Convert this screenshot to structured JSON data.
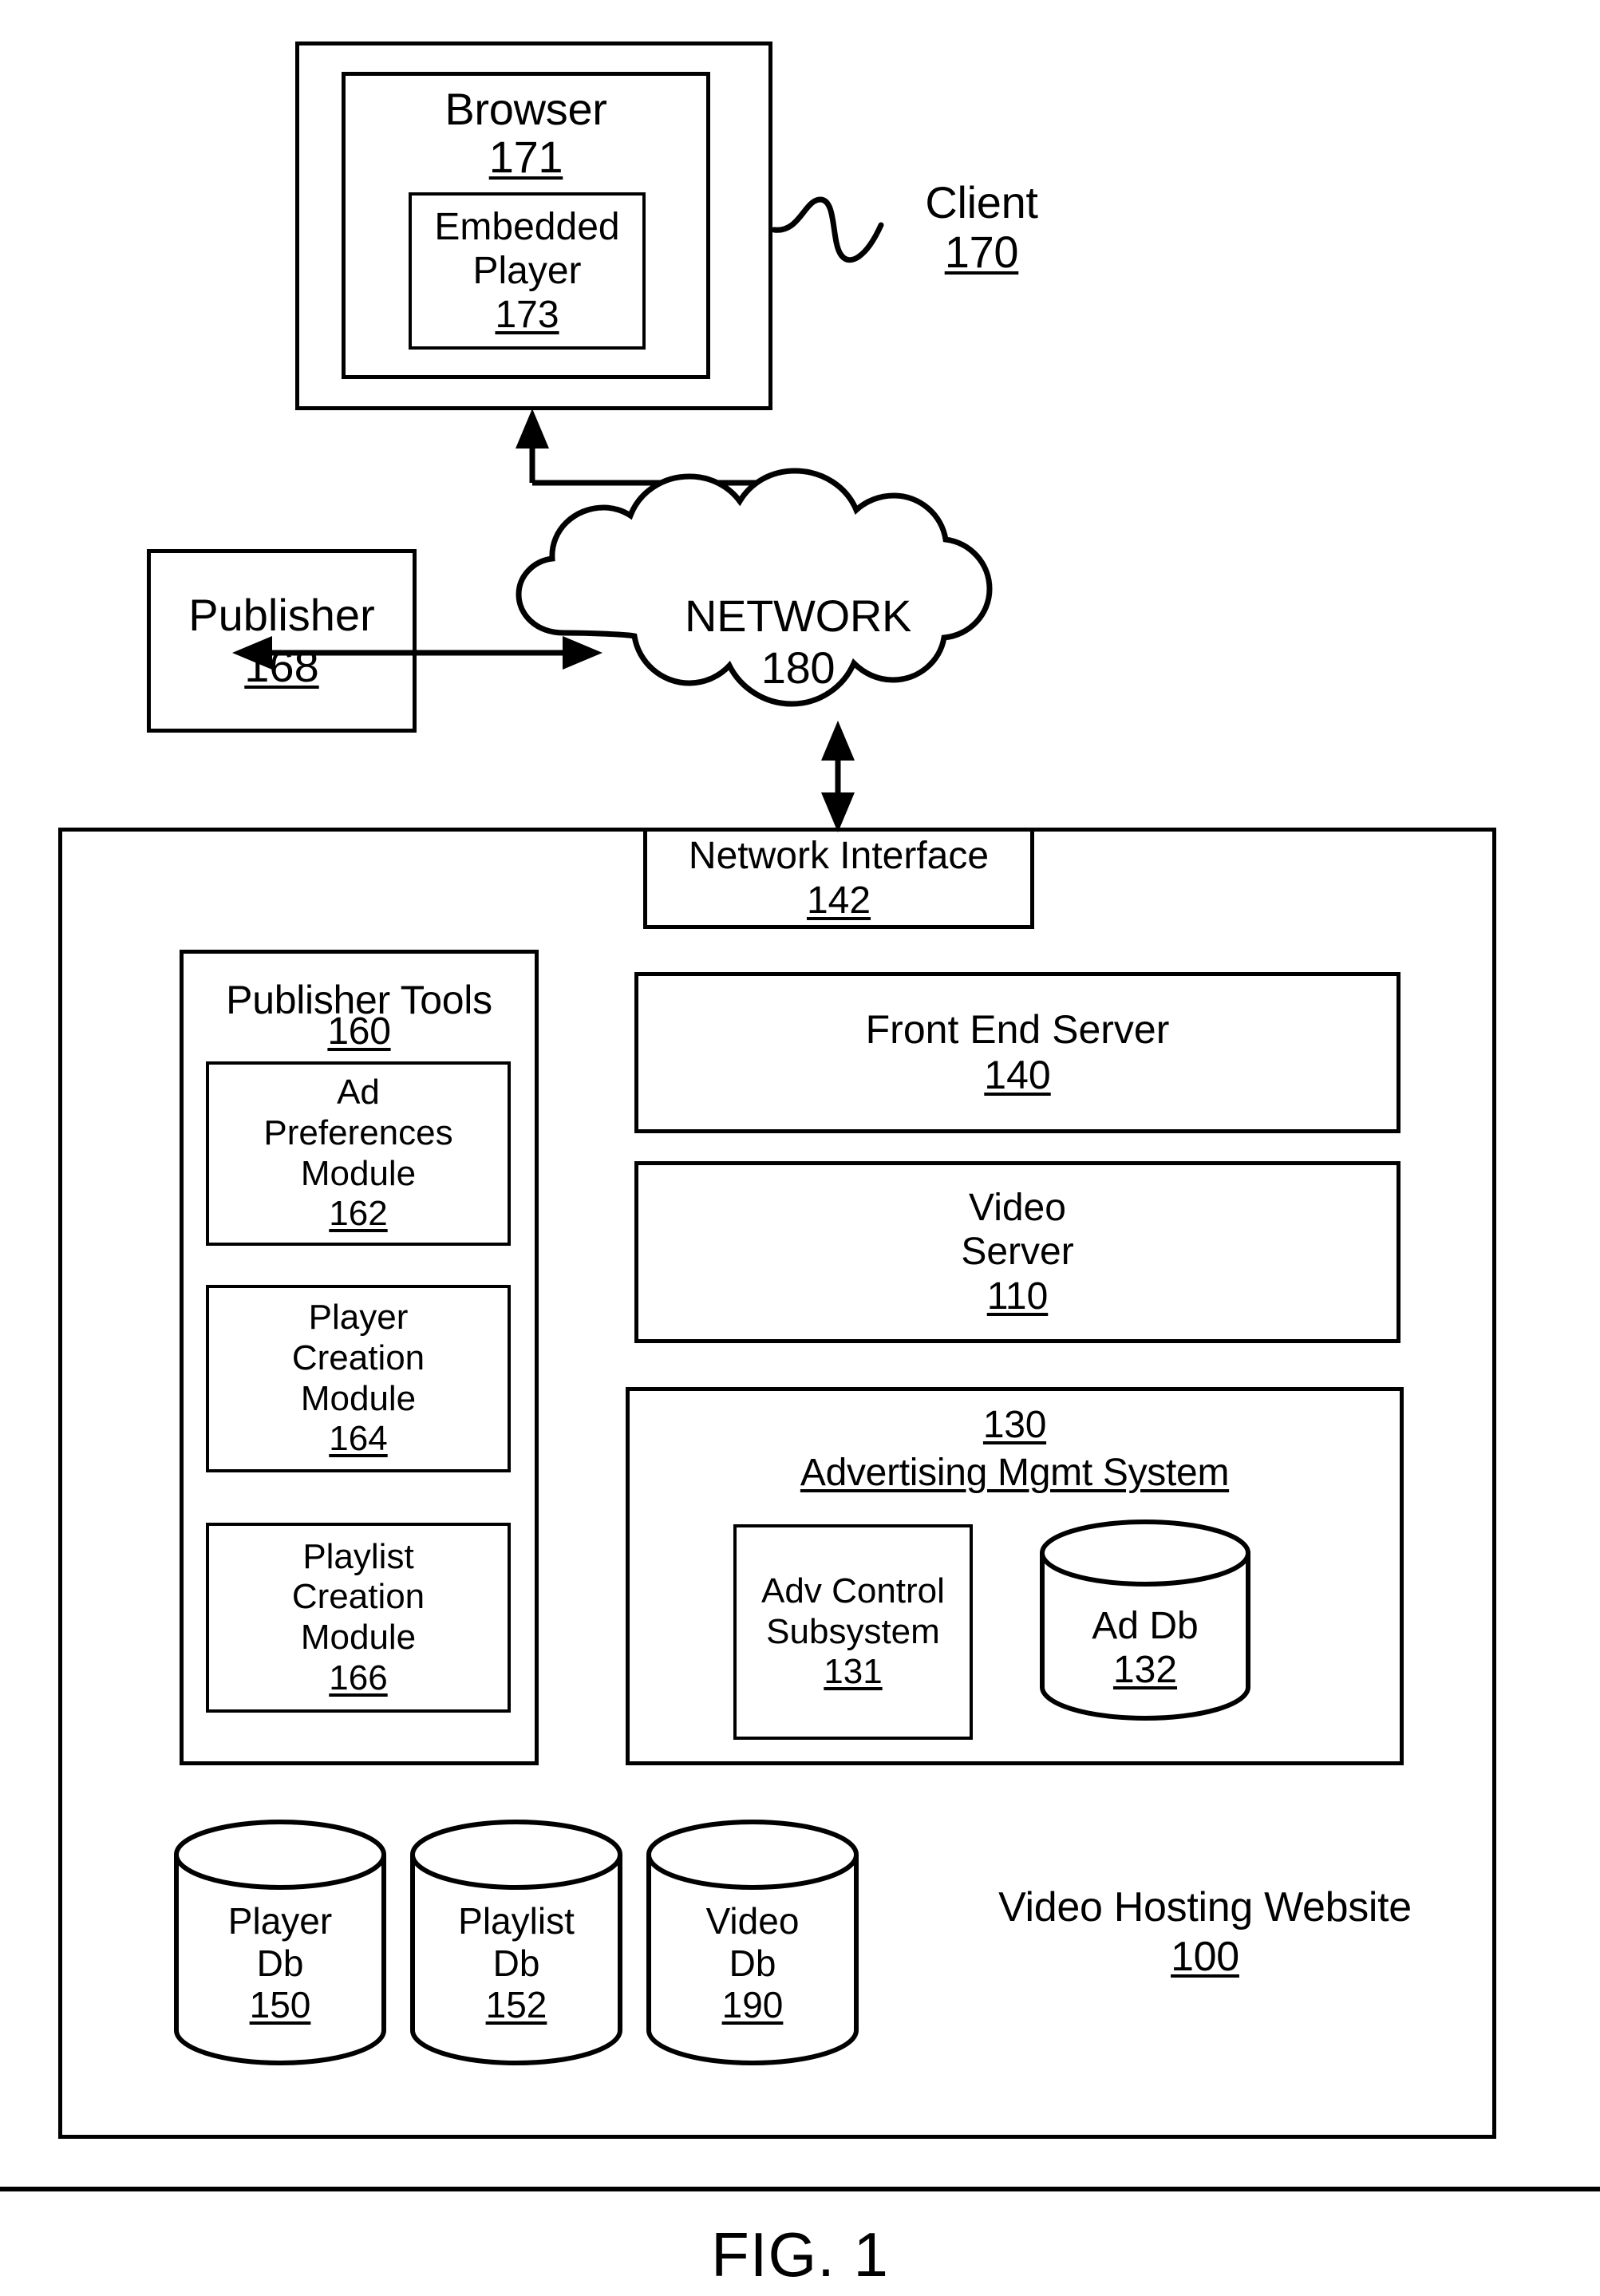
{
  "figure": {
    "caption": "FIG. 1"
  },
  "client": {
    "label": "Client",
    "number": "170",
    "browser": {
      "label": "Browser",
      "number": "171",
      "embedded_player": {
        "label_line1": "Embedded",
        "label_line2": "Player",
        "number": "173"
      }
    }
  },
  "publisher": {
    "label": "Publisher",
    "number": "168"
  },
  "network": {
    "label": "NETWORK",
    "number": "180"
  },
  "website": {
    "label": "Video Hosting Website",
    "number": "100",
    "network_interface": {
      "label": "Network Interface",
      "number": "142"
    },
    "front_end_server": {
      "label": "Front End Server",
      "number": "140"
    },
    "video_server": {
      "label_line1": "Video",
      "label_line2": "Server",
      "number": "110"
    },
    "publisher_tools": {
      "label": "Publisher Tools",
      "number": "160",
      "modules": [
        {
          "name": "ad-preferences-module",
          "line1": "Ad",
          "line2": "Preferences",
          "line3": "Module",
          "number": "162"
        },
        {
          "name": "player-creation-module",
          "line1": "Player",
          "line2": "Creation",
          "line3": "Module",
          "number": "164"
        },
        {
          "name": "playlist-creation-module",
          "line1": "Playlist",
          "line2": "Creation",
          "line3": "Module",
          "number": "166"
        }
      ]
    },
    "advertising_mgmt_system": {
      "number": "130",
      "label": "Advertising Mgmt System",
      "adv_control_subsystem": {
        "line1": "Adv Control",
        "line2": "Subsystem",
        "number": "131"
      },
      "ad_db": {
        "label": "Ad Db",
        "number": "132"
      }
    },
    "databases": [
      {
        "name": "player-db",
        "line1": "Player",
        "line2": "Db",
        "number": "150"
      },
      {
        "name": "playlist-db",
        "line1": "Playlist",
        "line2": "Db",
        "number": "152"
      },
      {
        "name": "video-db",
        "line1": "Video",
        "line2": "Db",
        "number": "190"
      }
    ]
  },
  "colors": {
    "stroke": "#000000",
    "background": "#ffffff"
  }
}
